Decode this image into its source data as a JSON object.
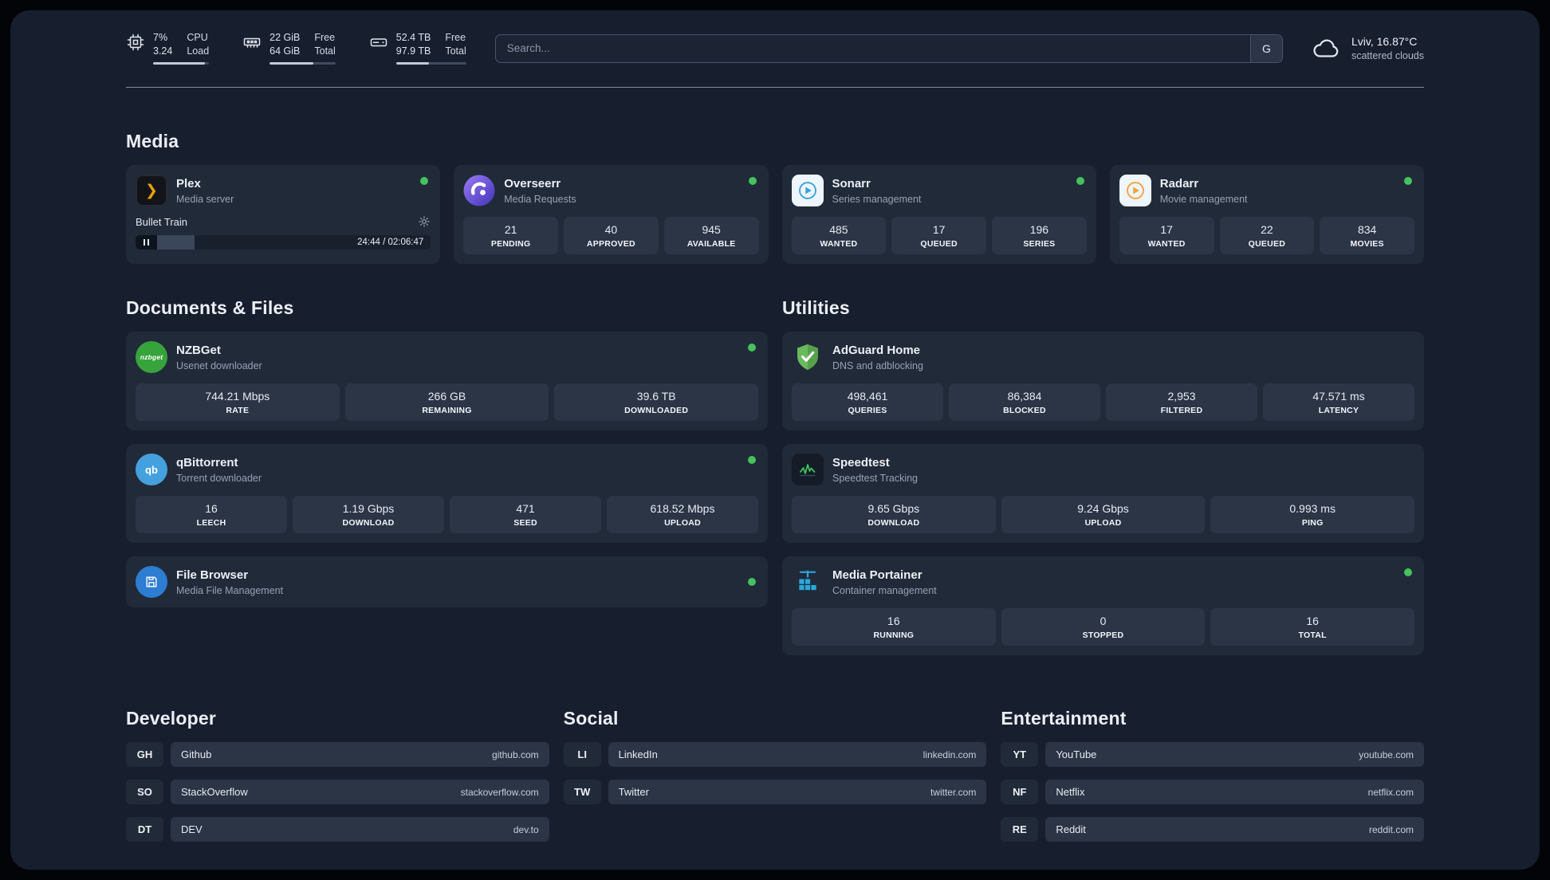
{
  "topbar": {
    "cpu": {
      "value_top": "7%",
      "value_bottom": "3.24",
      "label_top": "CPU",
      "label_bottom": "Load"
    },
    "ram": {
      "value_top": "22 GiB",
      "value_bottom": "64 GiB",
      "label_top": "Free",
      "label_bottom": "Total"
    },
    "disk": {
      "value_top": "52.4 TB",
      "value_bottom": "97.9 TB",
      "label_top": "Free",
      "label_bottom": "Total"
    },
    "search": {
      "placeholder": "Search...",
      "engine_badge": "G"
    },
    "weather": {
      "location": "Lviv, 16.87°C",
      "condition": "scattered clouds"
    }
  },
  "media": {
    "heading": "Media",
    "plex": {
      "title": "Plex",
      "subtitle": "Media server",
      "now_playing": "Bullet Train",
      "time": "24:44 / 02:06:47"
    },
    "overseerr": {
      "title": "Overseerr",
      "subtitle": "Media Requests",
      "stats": [
        {
          "value": "21",
          "label": "PENDING"
        },
        {
          "value": "40",
          "label": "APPROVED"
        },
        {
          "value": "945",
          "label": "AVAILABLE"
        }
      ]
    },
    "sonarr": {
      "title": "Sonarr",
      "subtitle": "Series management",
      "stats": [
        {
          "value": "485",
          "label": "WANTED"
        },
        {
          "value": "17",
          "label": "QUEUED"
        },
        {
          "value": "196",
          "label": "SERIES"
        }
      ]
    },
    "radarr": {
      "title": "Radarr",
      "subtitle": "Movie management",
      "stats": [
        {
          "value": "17",
          "label": "WANTED"
        },
        {
          "value": "22",
          "label": "QUEUED"
        },
        {
          "value": "834",
          "label": "MOVIES"
        }
      ]
    }
  },
  "documents": {
    "heading": "Documents & Files",
    "nzbget": {
      "title": "NZBGet",
      "subtitle": "Usenet downloader",
      "stats": [
        {
          "value": "744.21 Mbps",
          "label": "RATE"
        },
        {
          "value": "266 GB",
          "label": "REMAINING"
        },
        {
          "value": "39.6 TB",
          "label": "DOWNLOADED"
        }
      ]
    },
    "qbittorrent": {
      "title": "qBittorrent",
      "subtitle": "Torrent downloader",
      "stats": [
        {
          "value": "16",
          "label": "LEECH"
        },
        {
          "value": "1.19 Gbps",
          "label": "DOWNLOAD"
        },
        {
          "value": "471",
          "label": "SEED"
        },
        {
          "value": "618.52 Mbps",
          "label": "UPLOAD"
        }
      ]
    },
    "filebrowser": {
      "title": "File Browser",
      "subtitle": "Media File Management"
    }
  },
  "utilities": {
    "heading": "Utilities",
    "adguard": {
      "title": "AdGuard Home",
      "subtitle": "DNS and adblocking",
      "stats": [
        {
          "value": "498,461",
          "label": "QUERIES"
        },
        {
          "value": "86,384",
          "label": "BLOCKED"
        },
        {
          "value": "2,953",
          "label": "FILTERED"
        },
        {
          "value": "47.571 ms",
          "label": "LATENCY"
        }
      ]
    },
    "speedtest": {
      "title": "Speedtest",
      "subtitle": "Speedtest Tracking",
      "stats": [
        {
          "value": "9.65 Gbps",
          "label": "DOWNLOAD"
        },
        {
          "value": "9.24 Gbps",
          "label": "UPLOAD"
        },
        {
          "value": "0.993 ms",
          "label": "PING"
        }
      ]
    },
    "portainer": {
      "title": "Media Portainer",
      "subtitle": "Container management",
      "stats": [
        {
          "value": "16",
          "label": "RUNNING"
        },
        {
          "value": "0",
          "label": "STOPPED"
        },
        {
          "value": "16",
          "label": "TOTAL"
        }
      ]
    }
  },
  "links": {
    "developer": {
      "heading": "Developer",
      "items": [
        {
          "abbr": "GH",
          "name": "Github",
          "url": "github.com"
        },
        {
          "abbr": "SO",
          "name": "StackOverflow",
          "url": "stackoverflow.com"
        },
        {
          "abbr": "DT",
          "name": "DEV",
          "url": "dev.to"
        }
      ]
    },
    "social": {
      "heading": "Social",
      "items": [
        {
          "abbr": "LI",
          "name": "LinkedIn",
          "url": "linkedin.com"
        },
        {
          "abbr": "TW",
          "name": "Twitter",
          "url": "twitter.com"
        }
      ]
    },
    "entertainment": {
      "heading": "Entertainment",
      "items": [
        {
          "abbr": "YT",
          "name": "YouTube",
          "url": "youtube.com"
        },
        {
          "abbr": "NF",
          "name": "Netflix",
          "url": "netflix.com"
        },
        {
          "abbr": "RE",
          "name": "Reddit",
          "url": "reddit.com"
        }
      ]
    }
  },
  "icons": {
    "plex_glyph": "❯",
    "nzbget_text": "nzbget",
    "qbittorrent_text": "qb"
  },
  "colors": {
    "status_online": "#45c25e",
    "plex_gold": "#e5a00d",
    "sonarr_blue": "#36a3dc",
    "radarr_orange": "#f2a33c",
    "adguard_green": "#66b35e",
    "portainer_blue": "#29a8dd",
    "speedtest_green": "#3fca5a"
  }
}
